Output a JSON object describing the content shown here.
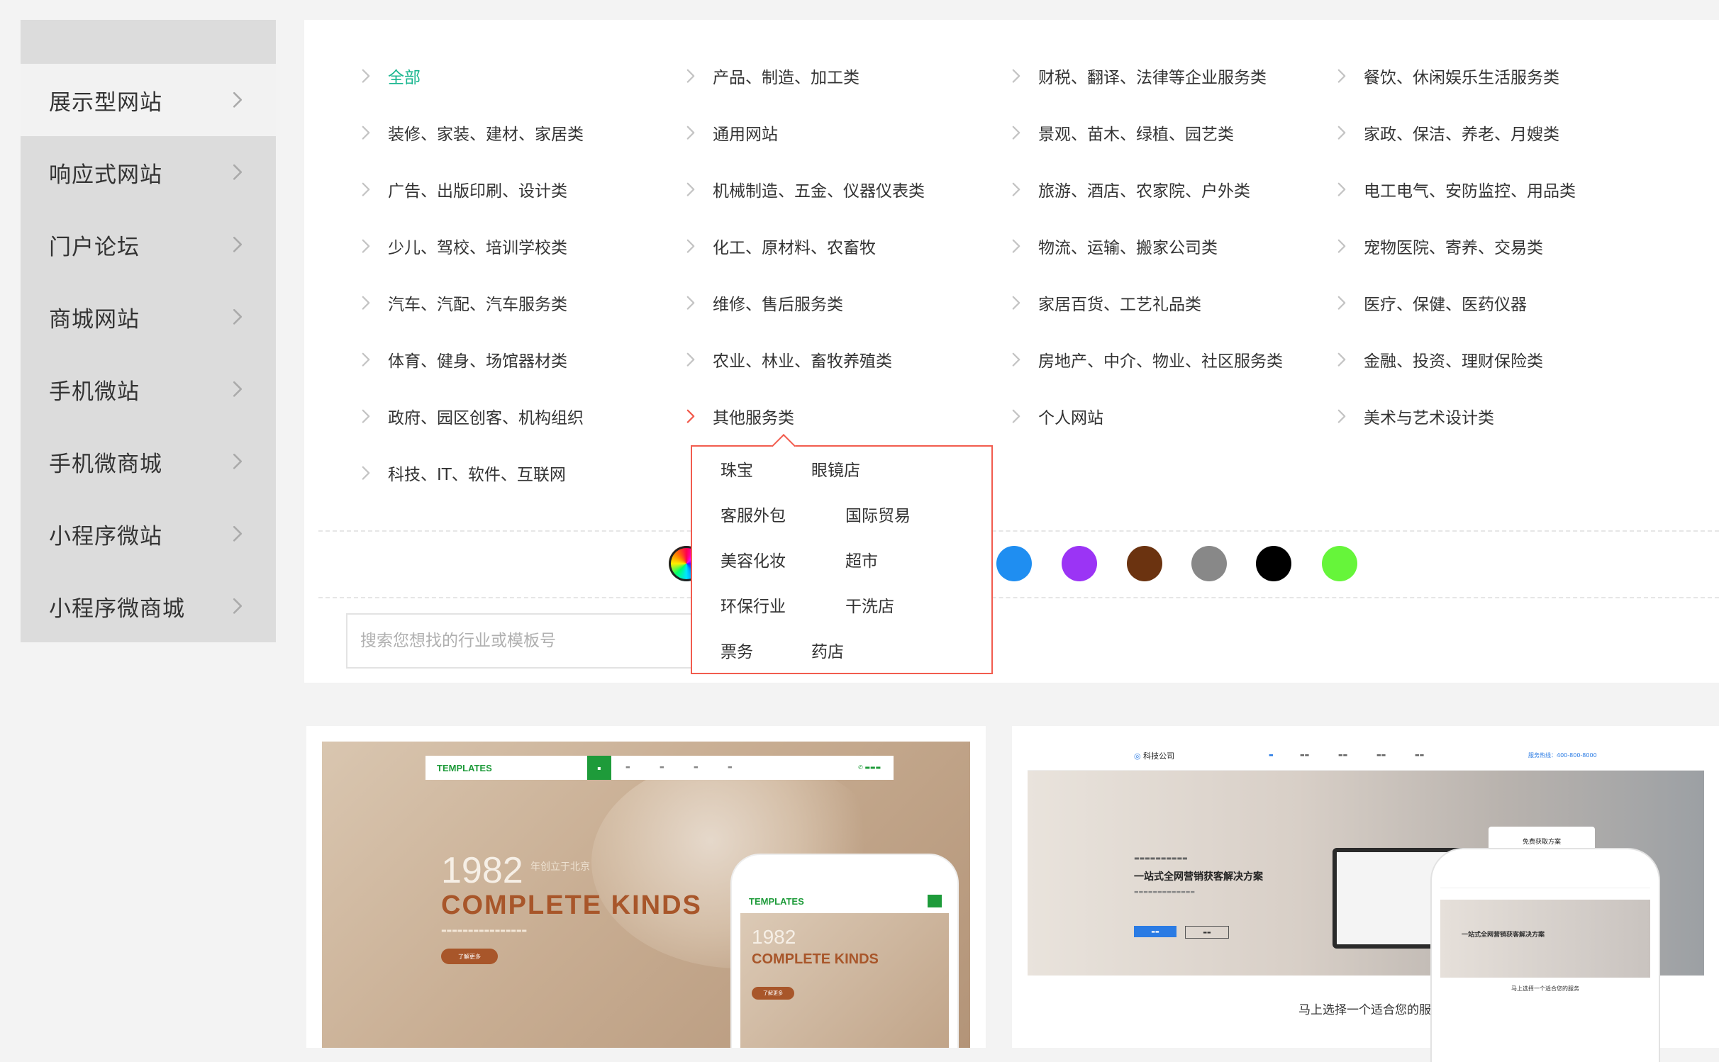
{
  "sidebar": {
    "items": [
      {
        "label": "展示型网站"
      },
      {
        "label": "响应式网站"
      },
      {
        "label": "门户论坛"
      },
      {
        "label": "商城网站"
      },
      {
        "label": "手机微站"
      },
      {
        "label": "手机微商城"
      },
      {
        "label": "小程序微站"
      },
      {
        "label": "小程序微商城"
      }
    ]
  },
  "categories": [
    [
      "全部",
      "产品、制造、加工类",
      "财税、翻译、法律等企业服务类",
      "餐饮、休闲娱乐生活服务类"
    ],
    [
      "装修、家装、建材、家居类",
      "通用网站",
      "景观、苗木、绿植、园艺类",
      "家政、保洁、养老、月嫂类"
    ],
    [
      "广告、出版印刷、设计类",
      "机械制造、五金、仪器仪表类",
      "旅游、酒店、农家院、户外类",
      "电工电气、安防监控、用品类"
    ],
    [
      "少儿、驾校、培训学校类",
      "化工、原材料、农畜牧",
      "物流、运输、搬家公司类",
      "宠物医院、寄养、交易类"
    ],
    [
      "汽车、汽配、汽车服务类",
      "维修、售后服务类",
      "家居百货、工艺礼品类",
      "医疗、保健、医药仪器"
    ],
    [
      "体育、健身、场馆器材类",
      "农业、林业、畜牧养殖类",
      "房地产、中介、物业、社区服务类",
      "金融、投资、理财保险类"
    ],
    [
      "政府、园区创客、机构组织",
      "其他服务类",
      "个人网站",
      "美术与艺术设计类"
    ],
    [
      "科技、IT、软件、互联网"
    ]
  ],
  "active_category": "全部",
  "open_category": "其他服务类",
  "dropdown": {
    "items": [
      [
        "珠宝",
        "眼镜店"
      ],
      [
        "客服外包",
        "国际贸易"
      ],
      [
        "美容化妆",
        "超市"
      ],
      [
        "环保行业",
        "干洗店"
      ],
      [
        "票务",
        "药店"
      ]
    ]
  },
  "colors": {
    "accent": "#18b68f",
    "dropdown_border": "#f25c4e",
    "swatches": [
      "rainbow",
      "#1f8ef1",
      "#9b34f5",
      "#6b3310",
      "#888888",
      "#000000",
      "#66f53a"
    ]
  },
  "search": {
    "placeholder": "搜索您想找的行业或模板号",
    "value": ""
  },
  "templates": [
    {
      "brand": "TEMPLATES",
      "year": "1982",
      "year_sub": "年创立于北京",
      "headline": "COMPLETE KINDS",
      "button": "了解更多",
      "phone_brand": "TEMPLATES",
      "phone_year": "1982",
      "phone_headline": "COMPLETE KINDS",
      "phone_button": "了解更多"
    },
    {
      "logo": "科技公司",
      "phone": "服务热线：400-800-8000",
      "hero_title": "一站式全网营销获客解决方案",
      "form_title": "免费获取方案",
      "section_title": "马上选择一个适合您的服务"
    }
  ]
}
